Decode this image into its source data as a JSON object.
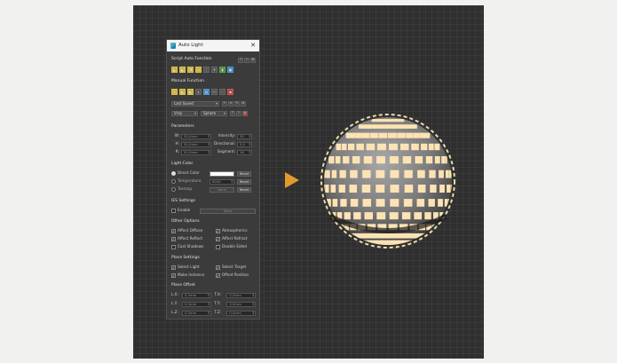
{
  "window": {
    "title": "Auto Light",
    "close_glyph": "✕"
  },
  "sections": {
    "script_auto": "Script Auto Function",
    "manual": "Manual Function",
    "parameters": "Parameters",
    "light_color": "Light Color",
    "ies": "IES Settings",
    "other": "Other Options",
    "place": "Place Settings",
    "offset": "Place Offset"
  },
  "manual": {
    "light_type": "Last Saved",
    "renderer": "Vray",
    "shape": "Sphere"
  },
  "parameters": {
    "w_label": "W:",
    "w_value": "50,0mm",
    "h_label": "H:",
    "h_value": "50,0mm",
    "r_label": "R:",
    "r_value": "50,0mm",
    "intensity_label": "Intensity:",
    "intensity_value": "30",
    "directional_label": "Directional:",
    "directional_value": "0,0",
    "segment_label": "Segment:",
    "segment_value": "16"
  },
  "light_color": {
    "direct_label": "Direct Color",
    "temperature_label": "Temperature",
    "temperature_value": "6500",
    "texmap_label": "Texmap",
    "texmap_button": "None",
    "reset": "Reset",
    "swatch_color": "#ffffff"
  },
  "ies": {
    "enable_label": "Enable",
    "file_button": "None"
  },
  "other": {
    "affect_diffuse": "Affect Diffuse",
    "atmospherics": "Atmospherics",
    "affect_reflect": "Affect Reflect",
    "affect_refract": "Affect Refract",
    "cast_shadows": "Cast Shadows",
    "double_sided": "Double Sided"
  },
  "place": {
    "select_light": "Select Light",
    "select_target": "Select Target",
    "make_instance": "Make Instance",
    "offset_position": "Offset Position"
  },
  "offset": {
    "lx_label": "L.X:",
    "lx_value": "0,0mm",
    "ly_label": "L.Y:",
    "ly_value": "0,0mm",
    "lz_label": "L.Z:",
    "lz_value": "0,0mm",
    "tx_label": "T.X:",
    "tx_value": "0,0mm",
    "ty_label": "T.Y:",
    "ty_value": "0,0mm",
    "tz_label": "T.Z:",
    "tz_value": "0,0mm"
  },
  "colors": {
    "viewport_bg": "#2f2f2f",
    "panel_bg": "#3b3b3b",
    "arrow": "#e29a2d",
    "light_tile": "#fde3b4",
    "sphere_base": "#8a8a8a"
  }
}
